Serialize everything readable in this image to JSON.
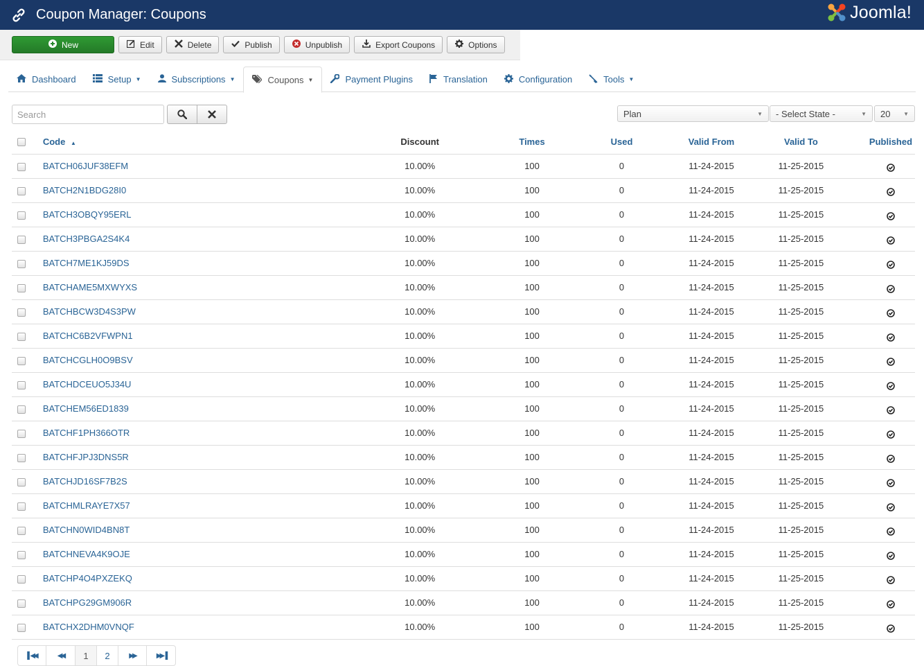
{
  "header": {
    "title": "Coupon Manager: Coupons",
    "logo_text": "Joomla!",
    "title_icon": "link-icon",
    "logo_icon": "joomla-logo-icon"
  },
  "toolbar": {
    "buttons": [
      {
        "label": "New",
        "icon": "plus-circle-icon"
      },
      {
        "label": "Edit",
        "icon": "edit-icon"
      },
      {
        "label": "Delete",
        "icon": "close-icon"
      },
      {
        "label": "Publish",
        "icon": "check-icon"
      },
      {
        "label": "Unpublish",
        "icon": "unpublish-circle-icon"
      },
      {
        "label": "Export Coupons",
        "icon": "download-icon"
      },
      {
        "label": "Options",
        "icon": "gear-icon"
      }
    ]
  },
  "nav": {
    "tabs": [
      {
        "label": "Dashboard",
        "icon": "home-icon",
        "dropdown": false
      },
      {
        "label": "Setup",
        "icon": "list-icon",
        "dropdown": true
      },
      {
        "label": "Subscriptions",
        "icon": "user-icon",
        "dropdown": true
      },
      {
        "label": "Coupons",
        "icon": "tag-icon",
        "dropdown": true,
        "active": true
      },
      {
        "label": "Payment Plugins",
        "icon": "wrench-icon",
        "dropdown": false
      },
      {
        "label": "Translation",
        "icon": "flag-icon",
        "dropdown": false
      },
      {
        "label": "Configuration",
        "icon": "gear-icon",
        "dropdown": false
      },
      {
        "label": "Tools",
        "icon": "tools-icon",
        "dropdown": true
      }
    ]
  },
  "filters": {
    "search_placeholder": "Search",
    "search_value": "",
    "plan_selected": "Plan",
    "state_selected": "- Select State -",
    "limit_selected": "20"
  },
  "table": {
    "columns": {
      "code": "Code",
      "discount": "Discount",
      "times": "Times",
      "used": "Used",
      "valid_from": "Valid From",
      "valid_to": "Valid To",
      "published": "Published"
    },
    "sort_indicator": "▲",
    "rows": [
      {
        "code": "BATCH06JUF38EFM",
        "discount": "10.00%",
        "times": "100",
        "used": "0",
        "valid_from": "11-24-2015",
        "valid_to": "11-25-2015",
        "published": true
      },
      {
        "code": "BATCH2N1BDG28I0",
        "discount": "10.00%",
        "times": "100",
        "used": "0",
        "valid_from": "11-24-2015",
        "valid_to": "11-25-2015",
        "published": true
      },
      {
        "code": "BATCH3OBQY95ERL",
        "discount": "10.00%",
        "times": "100",
        "used": "0",
        "valid_from": "11-24-2015",
        "valid_to": "11-25-2015",
        "published": true
      },
      {
        "code": "BATCH3PBGA2S4K4",
        "discount": "10.00%",
        "times": "100",
        "used": "0",
        "valid_from": "11-24-2015",
        "valid_to": "11-25-2015",
        "published": true
      },
      {
        "code": "BATCH7ME1KJ59DS",
        "discount": "10.00%",
        "times": "100",
        "used": "0",
        "valid_from": "11-24-2015",
        "valid_to": "11-25-2015",
        "published": true
      },
      {
        "code": "BATCHAME5MXWYXS",
        "discount": "10.00%",
        "times": "100",
        "used": "0",
        "valid_from": "11-24-2015",
        "valid_to": "11-25-2015",
        "published": true
      },
      {
        "code": "BATCHBCW3D4S3PW",
        "discount": "10.00%",
        "times": "100",
        "used": "0",
        "valid_from": "11-24-2015",
        "valid_to": "11-25-2015",
        "published": true
      },
      {
        "code": "BATCHC6B2VFWPN1",
        "discount": "10.00%",
        "times": "100",
        "used": "0",
        "valid_from": "11-24-2015",
        "valid_to": "11-25-2015",
        "published": true
      },
      {
        "code": "BATCHCGLH0O9BSV",
        "discount": "10.00%",
        "times": "100",
        "used": "0",
        "valid_from": "11-24-2015",
        "valid_to": "11-25-2015",
        "published": true
      },
      {
        "code": "BATCHDCEUO5J34U",
        "discount": "10.00%",
        "times": "100",
        "used": "0",
        "valid_from": "11-24-2015",
        "valid_to": "11-25-2015",
        "published": true
      },
      {
        "code": "BATCHEM56ED1839",
        "discount": "10.00%",
        "times": "100",
        "used": "0",
        "valid_from": "11-24-2015",
        "valid_to": "11-25-2015",
        "published": true
      },
      {
        "code": "BATCHF1PH366OTR",
        "discount": "10.00%",
        "times": "100",
        "used": "0",
        "valid_from": "11-24-2015",
        "valid_to": "11-25-2015",
        "published": true
      },
      {
        "code": "BATCHFJPJ3DNS5R",
        "discount": "10.00%",
        "times": "100",
        "used": "0",
        "valid_from": "11-24-2015",
        "valid_to": "11-25-2015",
        "published": true
      },
      {
        "code": "BATCHJD16SF7B2S",
        "discount": "10.00%",
        "times": "100",
        "used": "0",
        "valid_from": "11-24-2015",
        "valid_to": "11-25-2015",
        "published": true
      },
      {
        "code": "BATCHMLRAYE7X57",
        "discount": "10.00%",
        "times": "100",
        "used": "0",
        "valid_from": "11-24-2015",
        "valid_to": "11-25-2015",
        "published": true
      },
      {
        "code": "BATCHN0WID4BN8T",
        "discount": "10.00%",
        "times": "100",
        "used": "0",
        "valid_from": "11-24-2015",
        "valid_to": "11-25-2015",
        "published": true
      },
      {
        "code": "BATCHNEVA4K9OJE",
        "discount": "10.00%",
        "times": "100",
        "used": "0",
        "valid_from": "11-24-2015",
        "valid_to": "11-25-2015",
        "published": true
      },
      {
        "code": "BATCHP4O4PXZEKQ",
        "discount": "10.00%",
        "times": "100",
        "used": "0",
        "valid_from": "11-24-2015",
        "valid_to": "11-25-2015",
        "published": true
      },
      {
        "code": "BATCHPG29GM906R",
        "discount": "10.00%",
        "times": "100",
        "used": "0",
        "valid_from": "11-24-2015",
        "valid_to": "11-25-2015",
        "published": true
      },
      {
        "code": "BATCHX2DHM0VNQF",
        "discount": "10.00%",
        "times": "100",
        "used": "0",
        "valid_from": "11-24-2015",
        "valid_to": "11-25-2015",
        "published": true
      }
    ]
  },
  "pagination": {
    "pages": [
      "1",
      "2"
    ],
    "current": "1"
  },
  "colors": {
    "header_bg": "#1a3867",
    "new_button": "#2f9a33",
    "link": "#2a6496"
  }
}
